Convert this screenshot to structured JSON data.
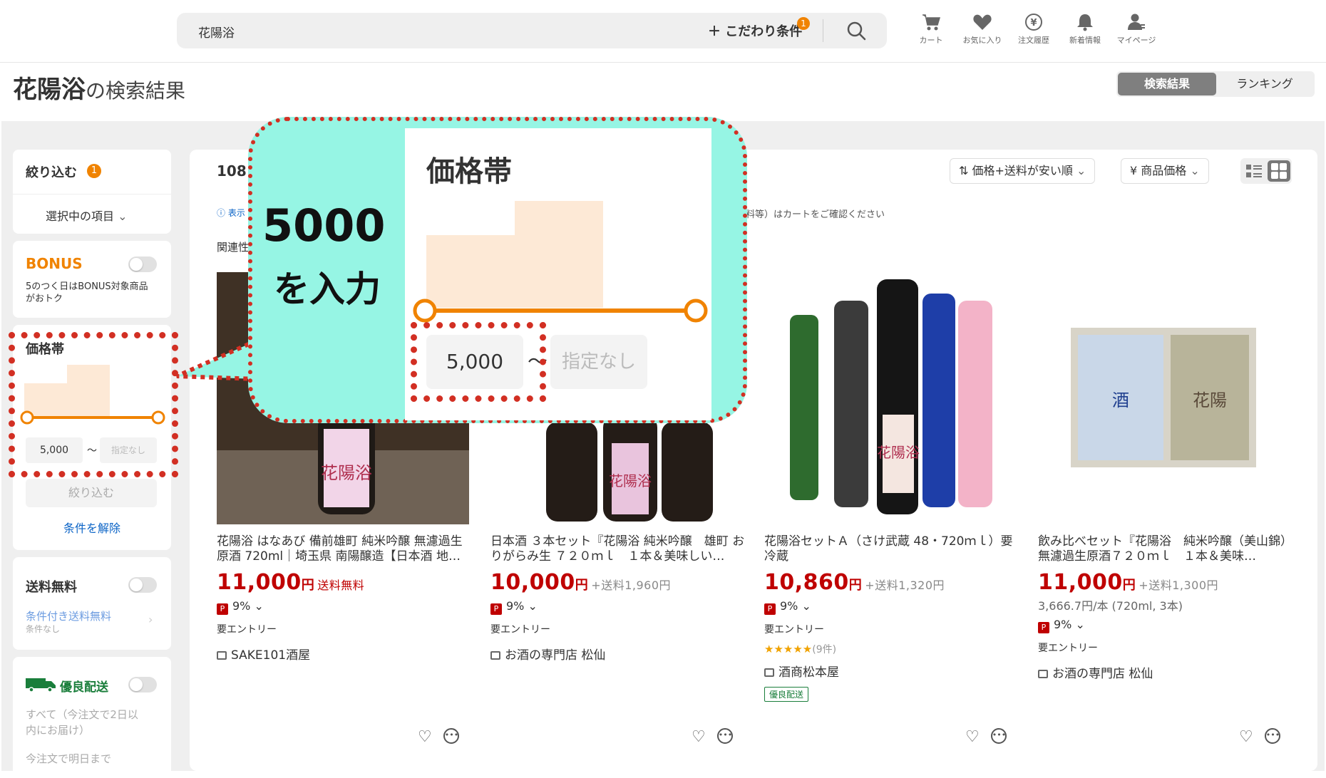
{
  "header": {
    "search_value": "花陽浴",
    "conditions_label": "＋ こだわり条件",
    "conditions_badge": "1",
    "icons": [
      {
        "name": "cart-icon",
        "label": "カート"
      },
      {
        "name": "heart-icon",
        "label": "お気に入り"
      },
      {
        "name": "yen-history-icon",
        "label": "注文履歴"
      },
      {
        "name": "bell-icon",
        "label": "新着情報"
      },
      {
        "name": "user-icon",
        "label": "マイページ"
      }
    ]
  },
  "page": {
    "query": "花陽浴",
    "title_suffix": "の検索結果",
    "tab_results": "検索結果",
    "tab_ranking": "ランキング"
  },
  "sidebar": {
    "filter_title": "絞り込む",
    "filter_badge": "1",
    "selected_items": "選択中の項目",
    "bonus_title": "BONUS",
    "bonus_desc": "5のつく日はBONUS対象商品がおトク",
    "price_title": "価格帯",
    "price_min": "5,000",
    "price_tilde": "～",
    "price_max_placeholder": "指定なし",
    "apply_button": "絞り込む",
    "clear_link": "条件を解除",
    "free_shipping_title": "送料無料",
    "cond_free_shipping": "条件付き送料無料",
    "cond_free_shipping_sub": "条件なし",
    "fast_delivery_title": "優良配送",
    "fast_delivery_desc": "すべて（今注文で2日以内にお届け）",
    "fast_delivery_desc2": "今注文で明日まで"
  },
  "results": {
    "count": "108",
    "notice_prefix": "表示",
    "notice_tail": "料等）はカートをご確認ください",
    "related_label": "関連性",
    "sort_label": "価格+送料が安い順",
    "price_sort_label": "商品価格"
  },
  "products": [
    {
      "title": "花陽浴 はなあび 備前雄町 純米吟醸 無濾過生原酒 720ml｜埼玉県 南陽醸造【日本酒 地…",
      "price": "11,000",
      "yen": "円",
      "shipping": "送料無料",
      "shipping_free": true,
      "unit": "",
      "point": "9%",
      "entry": "要エントリー",
      "shop": "SAKE101酒屋"
    },
    {
      "title": "日本酒 ３本セット『花陽浴 純米吟醸　雄町 おりがらみ生 ７２０ｍｌ　１本＆美味しい…",
      "price": "10,000",
      "yen": "円",
      "shipping": "+送料1,960円",
      "shipping_free": false,
      "unit": "",
      "point": "9%",
      "entry": "要エントリー",
      "shop": "お酒の専門店 松仙"
    },
    {
      "title": "花陽浴セットＡ（さけ武蔵 48・720ｍｌ）要冷蔵",
      "price": "10,860",
      "yen": "円",
      "shipping": "+送料1,320円",
      "shipping_free": false,
      "unit": "",
      "point": "9%",
      "entry": "要エントリー",
      "rating_stars": "★★★★★",
      "rating_count": "(9件)",
      "shop": "酒商松本屋",
      "badge": "優良配送"
    },
    {
      "title": "飲み比べセット『花陽浴　純米吟醸（美山錦）無濾過生原酒７２０ｍｌ　１本＆美味…",
      "price": "11,000",
      "yen": "円",
      "shipping": "+送料1,300円",
      "shipping_free": false,
      "unit": "3,666.7円/本 (720ml, 3本)",
      "point": "9%",
      "entry": "要エントリー",
      "shop": "お酒の専門店 松仙"
    }
  ],
  "callout": {
    "instruction_line1": "5000",
    "instruction_line2": "を入力",
    "price_title": "価格帯",
    "min_value": "5,000",
    "tilde": "～",
    "max_placeholder": "指定なし"
  },
  "colors": {
    "accent_orange": "#f08300",
    "price_red": "#bf0000",
    "callout_bg": "#96f5e4",
    "dotted_red": "#d22f23",
    "histogram": "#fde9d6"
  }
}
